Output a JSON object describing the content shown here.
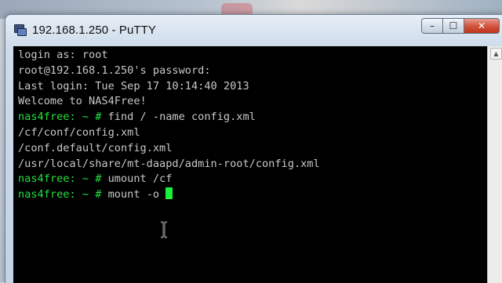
{
  "window": {
    "title": "192.168.1.250 - PuTTY",
    "controls": {
      "minimize_icon": "–",
      "maximize_icon": "☐",
      "close_icon": "✕"
    }
  },
  "terminal": {
    "lines": [
      {
        "text": "login as: root"
      },
      {
        "text": "root@192.168.1.250's password:"
      },
      {
        "text": "Last login: Tue Sep 17 10:14:40 2013"
      },
      {
        "text": "Welcome to NAS4Free!"
      },
      {
        "prompt": "nas4free: ~ #",
        "command": " find / -name config.xml"
      },
      {
        "text": "/cf/conf/config.xml"
      },
      {
        "text": "/conf.default/config.xml"
      },
      {
        "text": "/usr/local/share/mt-daapd/admin-root/config.xml"
      },
      {
        "prompt": "nas4free: ~ #",
        "command": " umount /cf"
      },
      {
        "prompt": "nas4free: ~ #",
        "command": " mount -o "
      }
    ]
  },
  "colors": {
    "terminal_bg": "#000000",
    "terminal_fg": "#c8c8c8",
    "prompt_green": "#22e13c",
    "cursor_green": "#19f03a"
  }
}
